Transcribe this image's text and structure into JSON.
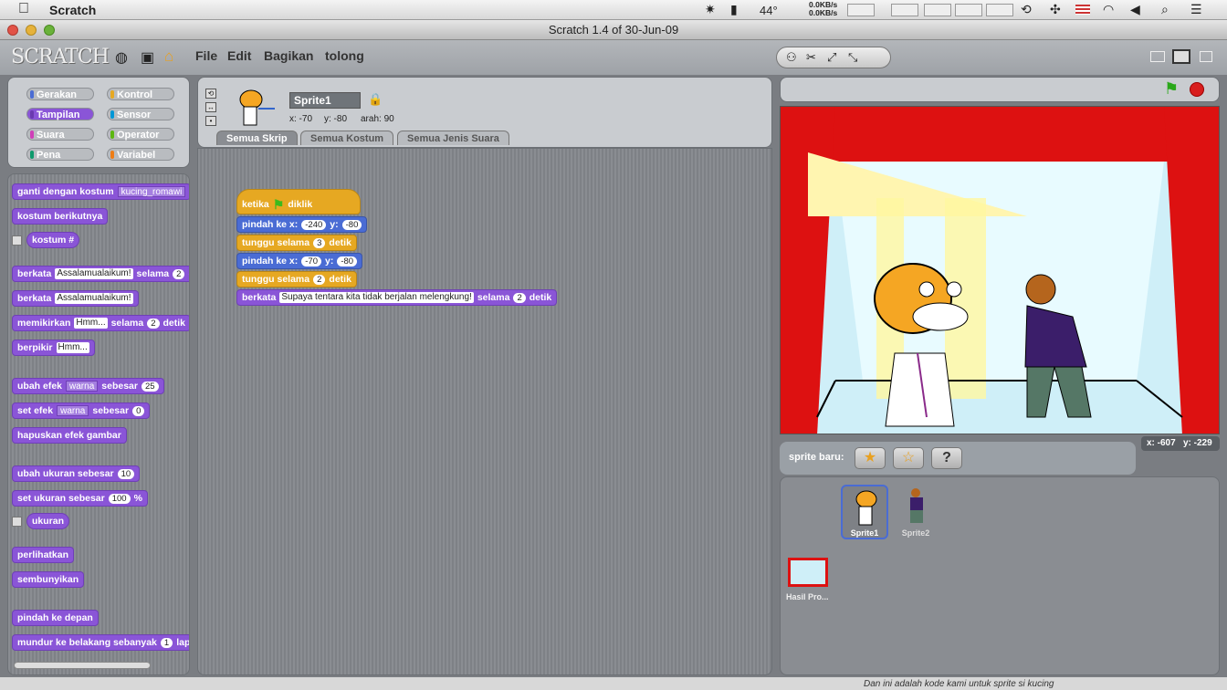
{
  "menubar": {
    "app": "Scratch",
    "temp": "44°",
    "net_up": "0.0KB/s",
    "net_down": "0.0KB/s"
  },
  "window": {
    "title": "Scratch 1.4 of 30-Jun-09"
  },
  "toolbar": {
    "logo": "SCRATCH",
    "menu": [
      "File",
      "Edit",
      "Bagikan",
      "tolong"
    ]
  },
  "categories": [
    {
      "label": "Gerakan",
      "color": "#4a6cd4"
    },
    {
      "label": "Kontrol",
      "color": "#e6a822"
    },
    {
      "label": "Tampilan",
      "color": "#8a55d7"
    },
    {
      "label": "Sensor",
      "color": "#0097d6"
    },
    {
      "label": "Suara",
      "color": "#cf3fb8"
    },
    {
      "label": "Operator",
      "color": "#5cb712"
    },
    {
      "label": "Pena",
      "color": "#0e9a6c"
    },
    {
      "label": "Variabel",
      "color": "#ee7d16"
    }
  ],
  "palette": {
    "b1": "ganti dengan kostum",
    "b1_dd": "kucing_romawi",
    "b2": "kostum berikutnya",
    "b3": "kostum #",
    "b4": "berkata",
    "b4_text": "Assalamualaikum!",
    "b4_sel": "selama",
    "b4_num": "2",
    "b4_cut": "d",
    "b5": "berkata",
    "b5_text": "Assalamualaikum!",
    "b6": "memikirkan",
    "b6_text": "Hmm...",
    "b6_sel": "selama",
    "b6_num": "2",
    "b6_det": "detik",
    "b7": "berpikir",
    "b7_text": "Hmm...",
    "b8": "ubah efek",
    "b8_dd": "warna",
    "b8_seb": "sebesar",
    "b8_num": "25",
    "b9": "set efek",
    "b9_dd": "warna",
    "b9_seb": "sebesar",
    "b9_num": "0",
    "b10": "hapuskan efek gambar",
    "b11": "ubah ukuran sebesar",
    "b11_num": "10",
    "b12": "set ukuran sebesar",
    "b12_num": "100",
    "b12_pct": "%",
    "b13": "ukuran",
    "b14": "perlihatkan",
    "b15": "sembunyikan",
    "b16": "pindah ke depan",
    "b17": "mundur ke belakang sebanyak",
    "b17_num": "1",
    "b17_tail": "lapis"
  },
  "sprite": {
    "name": "Sprite1",
    "x": "x: -70",
    "y": "y: -80",
    "dir": "arah: 90"
  },
  "tabs": [
    "Semua Skrip",
    "Semua Kostum",
    "Semua Jenis Suara"
  ],
  "script": {
    "hat": "ketika",
    "hat_end": "diklik",
    "s1": "pindah ke x:",
    "s1_x": "-240",
    "s1_y_l": "y:",
    "s1_y": "-80",
    "s2": "tunggu selama",
    "s2_n": "3",
    "s2_d": "detik",
    "s3": "pindah ke x:",
    "s3_x": "-70",
    "s3_y_l": "y:",
    "s3_y": "-80",
    "s4": "tunggu selama",
    "s4_n": "2",
    "s4_d": "detik",
    "s5": "berkata",
    "s5_text": "Supaya tentara kita tidak berjalan melengkung!",
    "s5_sel": "selama",
    "s5_n": "2",
    "s5_d": "detik"
  },
  "stage": {
    "mouse_x": "x: -607",
    "mouse_y": "y: -229"
  },
  "sprites": {
    "label": "sprite baru:",
    "items": [
      "Sprite1",
      "Sprite2"
    ],
    "stage_label": "Hasil Pro..."
  },
  "bottom": {
    "text": "Dan ini adalah kode kami untuk sprite si kucing"
  }
}
